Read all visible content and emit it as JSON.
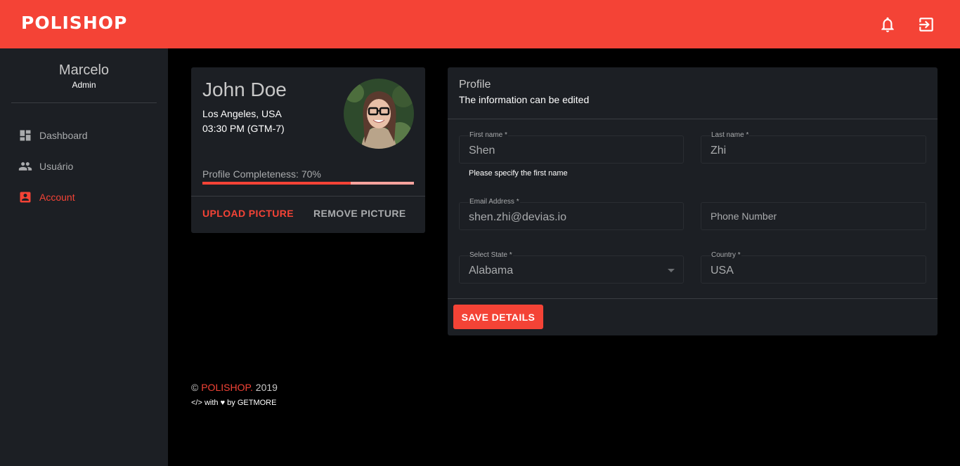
{
  "header": {
    "logo": "POLISHOP",
    "brand_color": "#f44336",
    "icons": [
      "bell-icon",
      "logout-icon"
    ]
  },
  "sidebar": {
    "user_name": "Marcelo",
    "user_role": "Admin",
    "items": [
      {
        "label": "Dashboard",
        "icon": "dashboard-icon",
        "active": false
      },
      {
        "label": "Usuário",
        "icon": "people-icon",
        "active": false
      },
      {
        "label": "Account",
        "icon": "account-box-icon",
        "active": true
      }
    ]
  },
  "profile_card": {
    "name": "John Doe",
    "location": "Los Angeles, USA",
    "time": "03:30 PM (GTM-7)",
    "completeness_label": "Profile Completeness: 70%",
    "completeness": 0.7,
    "upload_label": "UPLOAD PICTURE",
    "remove_label": "REMOVE PICTURE"
  },
  "profile_form": {
    "title": "Profile",
    "subtitle": "The information can be edited",
    "first_name": {
      "label": "First name *",
      "value": "Shen",
      "helper": "Please specify the first name"
    },
    "last_name": {
      "label": "Last name *",
      "value": "Zhi"
    },
    "email": {
      "label": "Email Address *",
      "value": "shen.zhi@devias.io"
    },
    "phone": {
      "placeholder": "Phone Number"
    },
    "state": {
      "label": "Select State *",
      "value": "Alabama"
    },
    "country": {
      "label": "Country *",
      "value": "USA"
    },
    "save_label": "SAVE DETAILS"
  },
  "footer": {
    "copyright": "©",
    "brand": "POLISHOP.",
    "year": "2019",
    "credit": "</> with ♥ by GETMORE"
  }
}
